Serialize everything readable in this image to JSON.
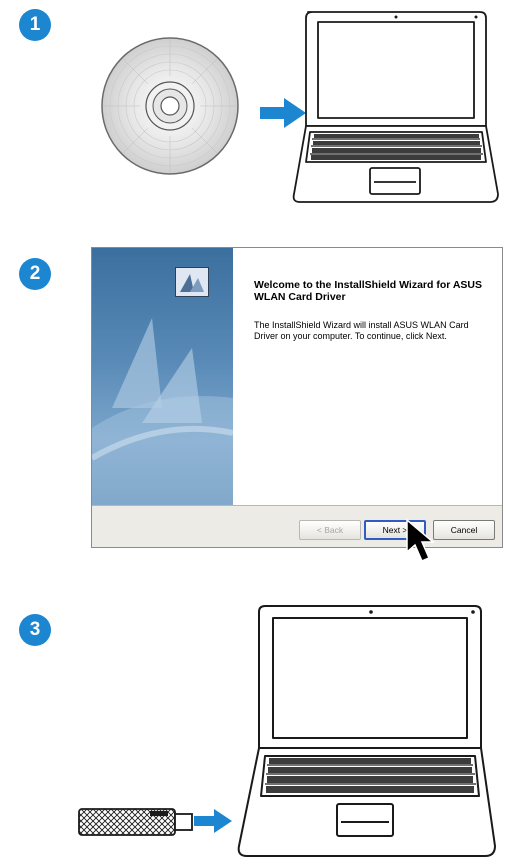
{
  "steps": [
    "1",
    "2",
    "3"
  ],
  "wizard": {
    "title": "Welcome to the InstallShield Wizard for ASUS WLAN Card Driver",
    "body": "The InstallShield Wizard will install ASUS  WLAN Card Driver on your computer.  To continue, click Next.",
    "back_label": "< Back",
    "next_label": "Next >",
    "cancel_label": "Cancel"
  },
  "colors": {
    "badge": "#1c86d1",
    "arrow": "#1c86d1"
  },
  "icons": [
    "cd-disc-icon",
    "arrow-right-icon",
    "laptop-icon",
    "installer-icon",
    "mouse-cursor-icon",
    "usb-adapter-icon"
  ]
}
